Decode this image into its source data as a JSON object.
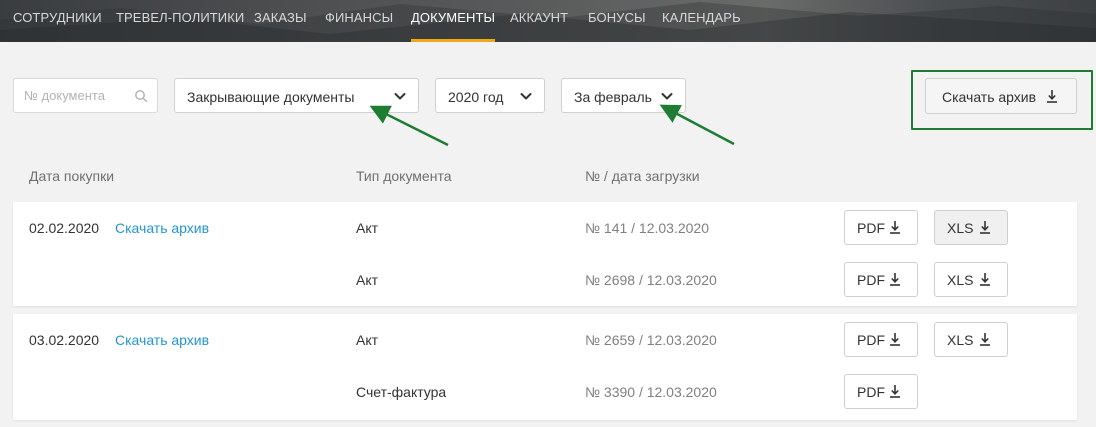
{
  "nav": {
    "items": [
      {
        "label": "СОТРУДНИКИ"
      },
      {
        "label": "ТРЕВЕЛ-ПОЛИТИКИ"
      },
      {
        "label": "ЗАКАЗЫ"
      },
      {
        "label": "ФИНАНСЫ"
      },
      {
        "label": "ДОКУМЕНТЫ",
        "active": true
      },
      {
        "label": "АККАУНТ"
      },
      {
        "label": "БОНУСЫ"
      },
      {
        "label": "КАЛЕНДАРЬ"
      }
    ]
  },
  "filters": {
    "search_placeholder": "№ документа",
    "doc_type": "Закрывающие документы",
    "year": "2020 год",
    "period": "За февраль",
    "download_archive": "Скачать архив"
  },
  "table": {
    "headers": {
      "date": "Дата покупки",
      "type": "Тип документа",
      "number": "№ / дата загрузки"
    },
    "groups": [
      {
        "date": "02.02.2020",
        "archive_link": "Скачать архив",
        "docs": [
          {
            "type": "Акт",
            "number": "№ 141 / 12.03.2020",
            "pdf": "PDF",
            "xls": "XLS"
          },
          {
            "type": "Акт",
            "number": "№ 2698 / 12.03.2020",
            "pdf": "PDF",
            "xls": "XLS"
          }
        ]
      },
      {
        "date": "03.02.2020",
        "archive_link": "Скачать архив",
        "docs": [
          {
            "type": "Акт",
            "number": "№ 2659 / 12.03.2020",
            "pdf": "PDF",
            "xls": "XLS"
          },
          {
            "type": "Счет-фактура",
            "number": "№ 3390 / 12.03.2020",
            "pdf": "PDF"
          }
        ]
      }
    ]
  },
  "colors": {
    "accent": "#f0a818",
    "link": "#2196d3",
    "highlight": "#1e7d33"
  }
}
